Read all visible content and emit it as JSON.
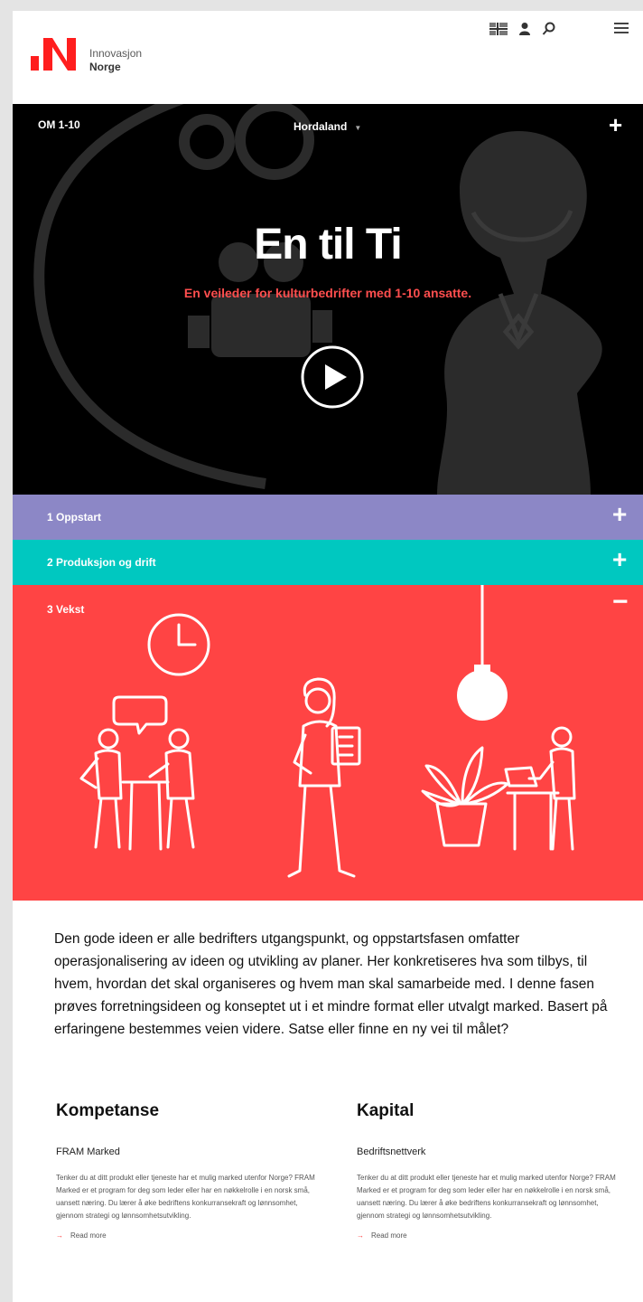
{
  "header": {
    "brand_line1": "Innovasjon",
    "brand_line2": "Norge",
    "icons": [
      "language-icon",
      "user-icon",
      "search-icon",
      "menu-icon"
    ]
  },
  "hero": {
    "nav_left": "OM 1-10",
    "region": "Hordaland",
    "plus": "+",
    "title": "En til Ti",
    "subtitle": "En veileder for kulturbedrifter med 1-10 ansatte."
  },
  "sections": [
    {
      "label": "1  Oppstart",
      "sign": "+"
    },
    {
      "label": "2  Produksjon og drift",
      "sign": "+"
    },
    {
      "label": "3  Vekst",
      "sign": "−"
    }
  ],
  "intro": "Den gode ideen er alle bedrifters utgangspunkt, og oppstartsfasen omfatter operasjonalisering av ideen og utvikling av planer. Her konkretiseres hva som tilbys, til hvem, hvordan det skal organiseres og hvem man skal samarbeide med. I denne fasen prøves forretningsideen og konseptet ut i et mindre format eller utvalgt marked. Basert på erfaringene bestemmes veien videre. Satse eller finne en ny vei til målet?",
  "columns": [
    {
      "heading": "Kompetanse",
      "item_title": "FRAM Marked",
      "description": "Tenker du at ditt produkt eller tjeneste har et mulig marked utenfor Norge? FRAM Marked er et program for deg som leder eller har en nøkkelrolle i en norsk små, uansett næring. Du lærer å øke bedriftens konkurransekraft og lønnsomhet, gjennom strategi og lønnsomhetsutvikling.",
      "read_more": "Read more"
    },
    {
      "heading": "Kapital",
      "item_title": "Bedriftsnettverk",
      "description": "Tenker du at ditt produkt eller tjeneste har et mulig marked utenfor Norge? FRAM Marked er et program for deg som leder eller har en nøkkelrolle i en norsk små, uansett næring. Du lærer å øke bedriftens konkurransekraft og lønnsomhet, gjennom strategi og lønnsomhetsutvikling.",
      "read_more": "Read more"
    }
  ],
  "colors": {
    "brand_red": "#ff4444",
    "purple": "#8c87c6",
    "teal": "#00c8c0",
    "hero_bg": "#000000"
  }
}
